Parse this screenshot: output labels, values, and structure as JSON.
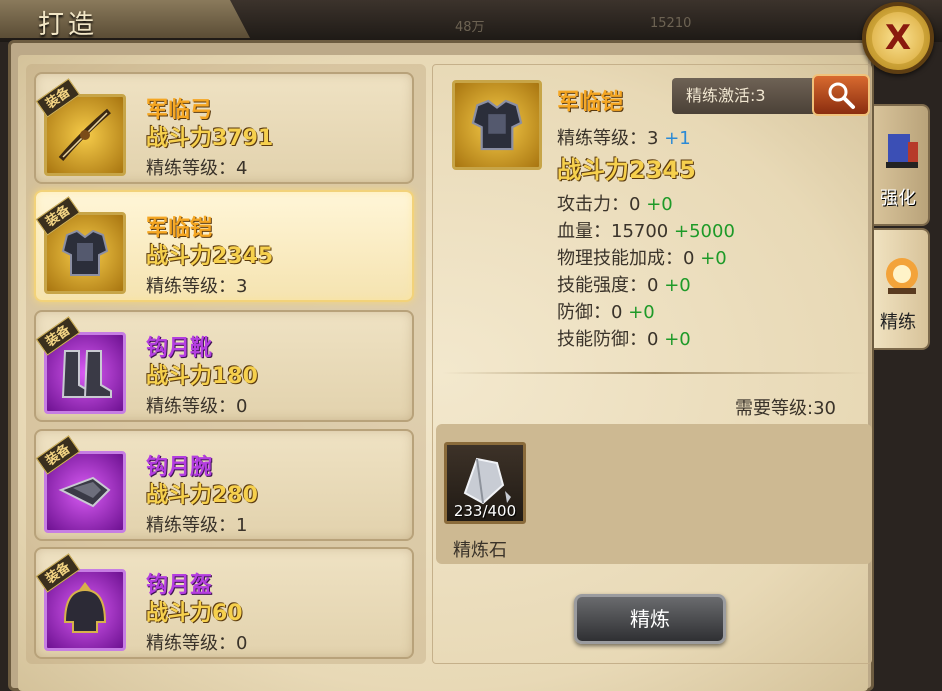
{
  "header": {
    "title": "打造",
    "faint_values": [
      "48万",
      "15210"
    ]
  },
  "item_list": [
    {
      "equip_tag": "装备",
      "name": "军临弓",
      "power": "战斗力3791",
      "refine_label": "精练等级：",
      "refine_level": "4",
      "rarity": "gold",
      "icon": "bow-icon"
    },
    {
      "equip_tag": "装备",
      "name": "军临铠",
      "power": "战斗力2345",
      "refine_label": "精练等级：",
      "refine_level": "3",
      "rarity": "gold",
      "icon": "armor-icon",
      "selected": true
    },
    {
      "equip_tag": "装备",
      "name": "钩月靴",
      "power": "战斗力180",
      "refine_label": "精练等级：",
      "refine_level": "0",
      "rarity": "purple",
      "icon": "boots-icon"
    },
    {
      "equip_tag": "装备",
      "name": "钩月腕",
      "power": "战斗力280",
      "refine_label": "精练等级：",
      "refine_level": "1",
      "rarity": "purple",
      "icon": "bracer-icon"
    },
    {
      "equip_tag": "装备",
      "name": "钩月盔",
      "power": "战斗力60",
      "refine_label": "精练等级：",
      "refine_level": "0",
      "rarity": "purple",
      "icon": "helmet-icon"
    }
  ],
  "detail": {
    "name": "军临铠",
    "refine_activate": "精练激活:3",
    "refine_level_label": "精练等级：",
    "refine_level": "3",
    "refine_level_plus": "+1",
    "power": "战斗力2345",
    "stats": [
      {
        "label": "攻击力：",
        "value": "0",
        "plus": "+0"
      },
      {
        "label": "血量：",
        "value": "15700",
        "plus": "+5000"
      },
      {
        "label": "物理技能加成：",
        "value": "0",
        "plus": "+0"
      },
      {
        "label": "技能强度：",
        "value": "0",
        "plus": "+0"
      },
      {
        "label": "防御：",
        "value": "0",
        "plus": "+0"
      },
      {
        "label": "技能防御：",
        "value": "0",
        "plus": "+0"
      }
    ],
    "required_level": "需要等级:30",
    "material": {
      "count": "233/400",
      "name": "精炼石"
    },
    "refine_button": "精炼"
  },
  "side_tabs": [
    {
      "label": "强化",
      "active": false
    },
    {
      "label": "精练",
      "active": true
    }
  ],
  "close_label": "X",
  "colors": {
    "gold_name": "#f5a622",
    "purple_name": "#b43ee0",
    "power": "#f6d04d",
    "plus_green": "#1e9a28",
    "plus_blue": "#2b8ad6"
  }
}
